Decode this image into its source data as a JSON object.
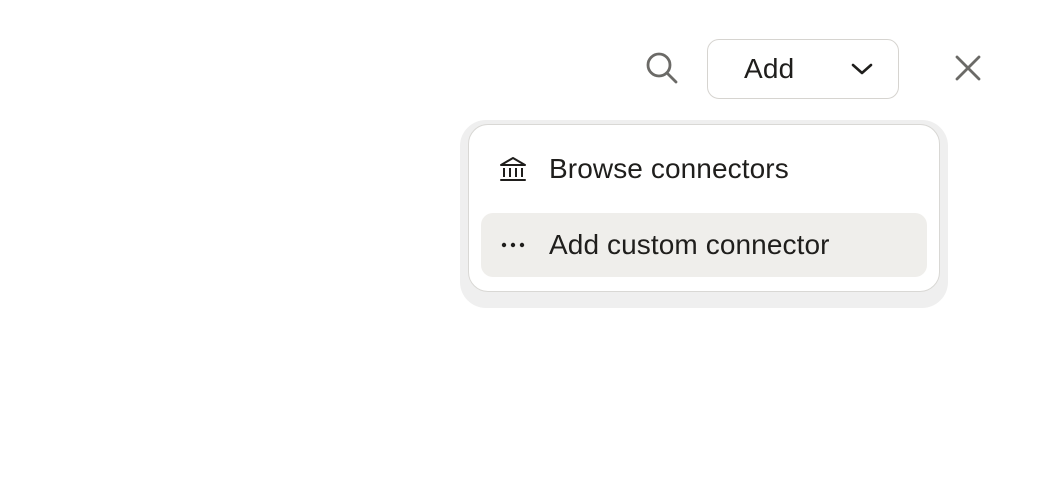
{
  "toolbar": {
    "search_icon": "search-icon",
    "add_select": {
      "label": "Add",
      "icon": "chevron-down-icon"
    },
    "close_icon": "close-icon"
  },
  "dropdown_menu": {
    "items": [
      {
        "label": "Browse connectors",
        "icon": "institution-icon",
        "highlighted": false
      },
      {
        "label": "Add custom connector",
        "icon": "more-horizontal-icon",
        "highlighted": true
      }
    ]
  },
  "colors": {
    "text": "#1f1e1c",
    "border": "#d6d4d0",
    "highlight": "#efeeeb",
    "icon": "#6b6a67"
  }
}
